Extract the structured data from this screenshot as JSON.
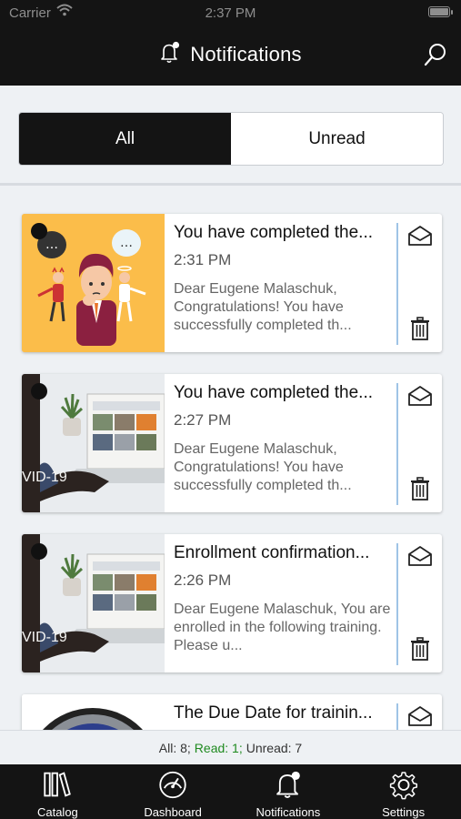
{
  "status": {
    "carrier": "Carrier",
    "time": "2:37 PM"
  },
  "header": {
    "title": "Notifications"
  },
  "segment": {
    "all": "All",
    "unread": "Unread",
    "selected": "All"
  },
  "notifications": [
    {
      "title": "You have completed the...",
      "time": "2:31 PM",
      "body": "Dear Eugene Malaschuk, Congratulations! You have successfully completed th...",
      "thumb": "cartoon-illustration"
    },
    {
      "title": "You have completed the...",
      "time": "2:27 PM",
      "body": "Dear Eugene Malaschuk, Congratulations! You have successfully completed th...",
      "thumb": "laptop-photo",
      "thumb_caption": "VID-19"
    },
    {
      "title": "Enrollment confirmation...",
      "time": "2:26 PM",
      "body": "Dear Eugene Malaschuk, You are enrolled in the following training. Please u...",
      "thumb": "laptop-photo",
      "thumb_caption": "VID-19"
    },
    {
      "title": "The Due Date for trainin...",
      "time": "",
      "body": "",
      "thumb": "globe-photo"
    }
  ],
  "summary": {
    "all": "All: 8;",
    "read": "Read: 1;",
    "unread": "Unread: 7"
  },
  "tabs": [
    {
      "label": "Catalog",
      "icon": "books-icon"
    },
    {
      "label": "Dashboard",
      "icon": "speedometer-icon"
    },
    {
      "label": "Notifications",
      "icon": "bell-icon"
    },
    {
      "label": "Settings",
      "icon": "gear-icon"
    }
  ],
  "colors": {
    "header_bg": "#141414",
    "read_green": "#1f8a1f",
    "accent_line": "#9fc4e6",
    "cartoon_bg": "#fbbd4a"
  }
}
